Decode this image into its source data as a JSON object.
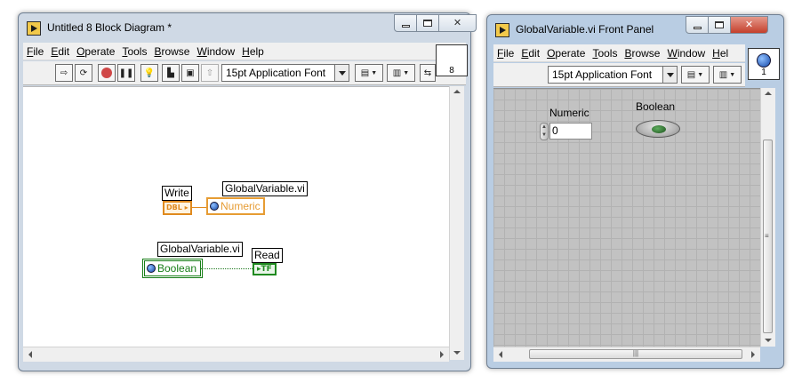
{
  "block_diagram": {
    "title": "Untitled 8 Block Diagram *",
    "menu": [
      {
        "mnemonic": "F",
        "rest": "ile"
      },
      {
        "mnemonic": "E",
        "rest": "dit"
      },
      {
        "mnemonic": "O",
        "rest": "perate"
      },
      {
        "mnemonic": "T",
        "rest": "ools"
      },
      {
        "mnemonic": "B",
        "rest": "rowse"
      },
      {
        "mnemonic": "W",
        "rest": "indow"
      },
      {
        "mnemonic": "H",
        "rest": "elp"
      }
    ],
    "font_select": "15pt Application Font",
    "vi_icon_number": "8",
    "nodes": {
      "write_label": "Write",
      "write_terminal": "DBL",
      "write_global_label": "GlobalVariable.vi",
      "write_global_name": "Numeric",
      "read_global_label": "GlobalVariable.vi",
      "read_global_name": "Boolean",
      "read_label": "Read",
      "read_terminal": "TF"
    }
  },
  "front_panel": {
    "title": "GlobalVariable.vi Front Panel",
    "menu": [
      {
        "mnemonic": "F",
        "rest": "ile"
      },
      {
        "mnemonic": "E",
        "rest": "dit"
      },
      {
        "mnemonic": "O",
        "rest": "perate"
      },
      {
        "mnemonic": "T",
        "rest": "ools"
      },
      {
        "mnemonic": "B",
        "rest": "rowse"
      },
      {
        "mnemonic": "W",
        "rest": "indow"
      },
      {
        "mnemonic": "H",
        "rest": "el"
      }
    ],
    "font_select": "15pt Application Font",
    "vi_icon_number": "1",
    "controls": {
      "numeric_label": "Numeric",
      "numeric_value": "0",
      "boolean_label": "Boolean"
    }
  },
  "colors": {
    "orange_wire": "#e08a1e",
    "green_wire": "#1f7a1f",
    "close_red": "#c4402c"
  }
}
